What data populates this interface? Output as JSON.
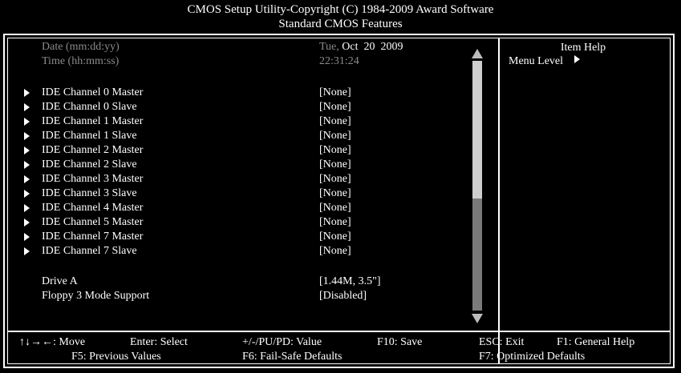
{
  "header": {
    "title_line1": "CMOS Setup Utility-Copyright (C) 1984-2009 Award Software",
    "title_line2": "Standard CMOS Features"
  },
  "datetime": {
    "date_label": "Date (mm:dd:yy)",
    "date_day": "Tue,",
    "date_value": "Oct  20  2009",
    "time_label": "Time (hh:mm:ss)",
    "time_value": "22:31:24"
  },
  "ide_channels": [
    {
      "label": "IDE Channel 0 Master",
      "value": "[None]"
    },
    {
      "label": "IDE Channel 0 Slave",
      "value": "[None]"
    },
    {
      "label": "IDE Channel 1 Master",
      "value": "[None]"
    },
    {
      "label": "IDE Channel 1 Slave",
      "value": "[None]"
    },
    {
      "label": "IDE Channel 2 Master",
      "value": "[None]"
    },
    {
      "label": "IDE Channel 2 Slave",
      "value": "[None]"
    },
    {
      "label": "IDE Channel 3 Master",
      "value": "[None]"
    },
    {
      "label": "IDE Channel 3 Slave",
      "value": "[None]"
    },
    {
      "label": "IDE Channel 4 Master",
      "value": "[None]"
    },
    {
      "label": "IDE Channel 5 Master",
      "value": "[None]"
    },
    {
      "label": "IDE Channel 7 Master",
      "value": "[None]"
    },
    {
      "label": "IDE Channel 7 Slave",
      "value": "[None]"
    }
  ],
  "drive_a": {
    "label": "Drive A",
    "value": "[1.44M, 3.5\"]"
  },
  "floppy_mode": {
    "label": "Floppy 3 Mode Support",
    "value": "[Disabled]"
  },
  "help_panel": {
    "title": "Item Help",
    "menu_level": "Menu Level"
  },
  "footer": {
    "move": "↑↓→←: Move",
    "enter": "Enter: Select",
    "value": "+/-/PU/PD: Value",
    "save": "F10: Save",
    "exit": "ESC: Exit",
    "help": "F1: General Help",
    "previous": "F5: Previous Values",
    "failsafe": "F6: Fail-Safe Defaults",
    "optimized": "F7: Optimized Defaults"
  },
  "scrollbar": {
    "position_fraction": 0,
    "visible_fraction": 0.55
  },
  "colors": {
    "background": "#000000",
    "text": "#ffffff",
    "dim_text": "#8a8a8a"
  }
}
